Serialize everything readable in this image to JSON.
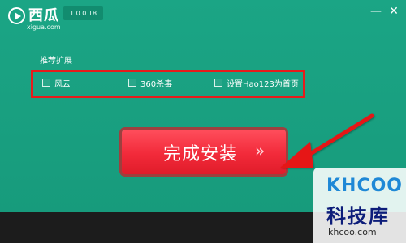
{
  "app": {
    "brand_name": "西瓜",
    "brand_domain": "xigua.com",
    "version": "1.0.0.18"
  },
  "window_controls": {
    "minimize": "—",
    "close": "✕"
  },
  "extensions": {
    "title": "推荐扩展",
    "options": [
      {
        "label": "风云",
        "checked": false
      },
      {
        "label": "360杀毒",
        "checked": false
      },
      {
        "label": "设置Hao123为首页",
        "checked": false
      }
    ]
  },
  "install_button": {
    "label": "完成安装",
    "arrows": "»"
  },
  "watermark": {
    "logo": "KHCOO",
    "name_cn": "科技库",
    "url": "khcoo.com"
  },
  "colors": {
    "window_bg": "#1aa183",
    "accent_red": "#f22a3a",
    "annotation_red": "#e71b1b",
    "watermark_blue": "#1e88d6"
  },
  "icons": {
    "logo": "play-circle-icon",
    "annotation": "red-arrow-icon"
  }
}
